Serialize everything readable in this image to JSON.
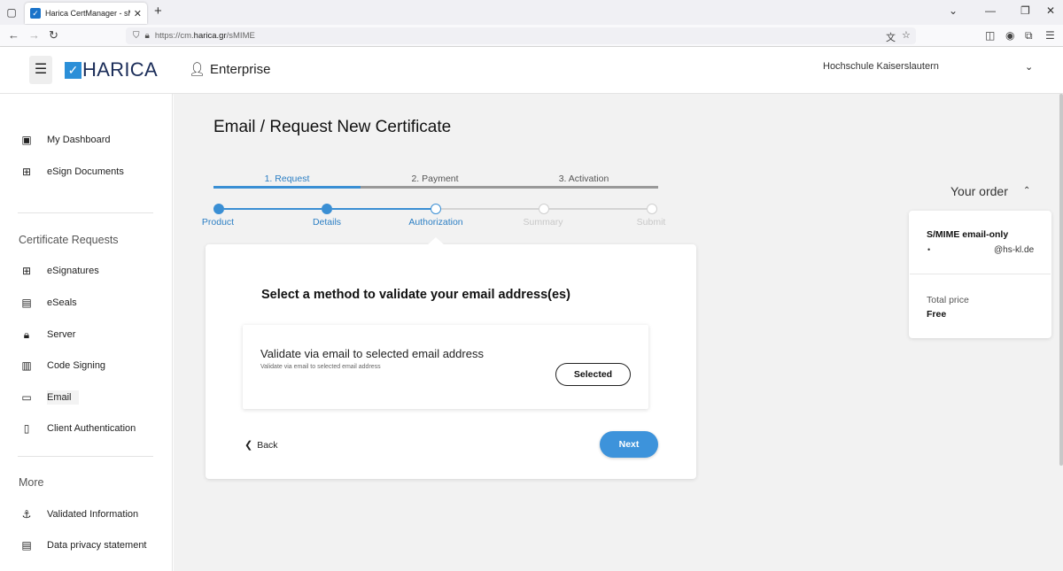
{
  "browser": {
    "tab_title": "Harica CertManager - sMIME",
    "url_prefix": "https://cm.",
    "url_domain": "harica.gr",
    "url_path": "/sMIME"
  },
  "header": {
    "brand": "HARICA",
    "section": "Enterprise",
    "institution": "Hochschule Kaiserslautern"
  },
  "sidebar": {
    "top_items": [
      {
        "label": "My Dashboard",
        "icon": "dashboard-icon"
      },
      {
        "label": "eSign Documents",
        "icon": "esign-icon"
      }
    ],
    "cert_heading": "Certificate Requests",
    "cert_items": [
      {
        "label": "eSignatures",
        "icon": "esignature-icon"
      },
      {
        "label": "eSeals",
        "icon": "eseal-icon"
      },
      {
        "label": "Server",
        "icon": "lock-icon"
      },
      {
        "label": "Code Signing",
        "icon": "code-icon"
      },
      {
        "label": "Email",
        "icon": "email-card-icon"
      },
      {
        "label": "Client Authentication",
        "icon": "badge-icon"
      }
    ],
    "more_heading": "More",
    "more_items": [
      {
        "label": "Validated Information",
        "icon": "anchor-icon"
      },
      {
        "label": "Data privacy statement",
        "icon": "id-card-icon"
      }
    ]
  },
  "page": {
    "title": "Email / Request New Certificate",
    "steps": [
      "1. Request",
      "2. Payment",
      "3. Activation"
    ],
    "substeps": [
      "Product",
      "Details",
      "Authorization",
      "Summary",
      "Submit"
    ],
    "card_title": "Select a method to validate your email address(es)",
    "method_title": "Validate via email to selected email address",
    "method_subtitle": "Validate via email to selected email address",
    "selected_label": "Selected",
    "back_label": "Back",
    "next_label": "Next"
  },
  "order": {
    "heading": "Your order",
    "product": "S/MIME email-only",
    "email_suffix": "@hs-kl.de",
    "total_label": "Total price",
    "total_value": "Free"
  },
  "colors": {
    "accent": "#3a8fd4",
    "brand_navy": "#1b2d59",
    "inactive": "#cfcfcf"
  }
}
